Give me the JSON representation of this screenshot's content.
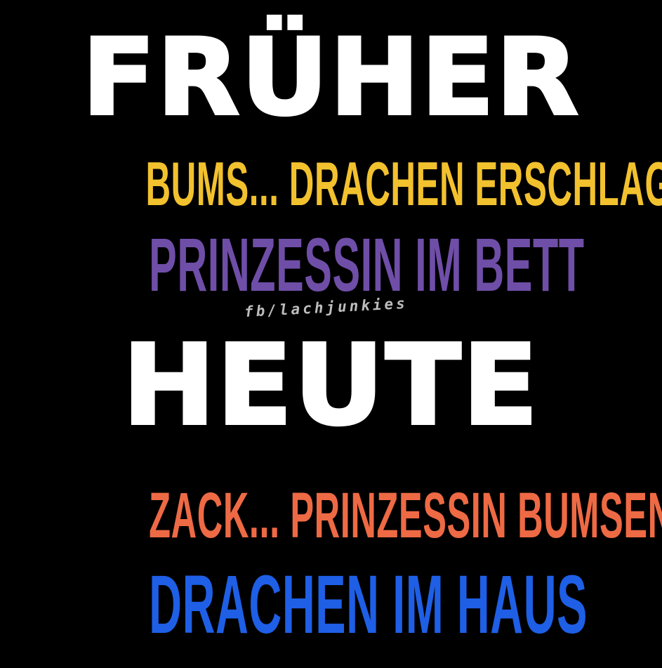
{
  "background_color": "#000000",
  "lines": {
    "frueher": {
      "text": "FRÜHER",
      "color": "#ffffff"
    },
    "line1": {
      "text": "BUMS... DRACHEN ERSCHLAGEN",
      "color": "#f2c12e"
    },
    "line2": {
      "text": "PRINZESSIN IM BETT",
      "color": "#6f4ea8"
    },
    "heute": {
      "text": "HEUTE",
      "color": "#ffffff"
    },
    "line3": {
      "text": "ZACK... PRINZESSIN BUMSEN",
      "color": "#ee6a44"
    },
    "line4": {
      "text": "DRACHEN IM HAUS",
      "color": "#1e5fe6"
    }
  },
  "watermark": {
    "text": "fb/lachjunkies",
    "color": "#bdbdbd"
  }
}
